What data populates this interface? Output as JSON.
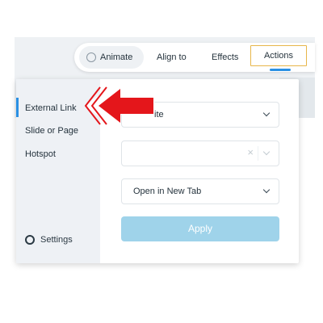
{
  "toolbar": {
    "animate_label": "Animate",
    "align_label": "Align to",
    "effects_label": "Effects",
    "actions_label": "Actions"
  },
  "sidebar": {
    "items": [
      {
        "label": "External Link",
        "active": true
      },
      {
        "label": "Slide or Page",
        "active": false
      },
      {
        "label": "Hotspot",
        "active": false
      }
    ],
    "settings_label": "Settings"
  },
  "form": {
    "link_type_value": "Website",
    "link_type_visible_text": "ite",
    "url_value": "",
    "open_in_value": "Open in New Tab",
    "apply_label": "Apply"
  },
  "colors": {
    "accent": "#2a90e4",
    "apply_button": "#9fd3ea",
    "actions_outline": "#e7b64a",
    "annotation_arrow": "#e4161b"
  },
  "annotation": {
    "type": "arrow-left",
    "points_to": "External Link"
  }
}
